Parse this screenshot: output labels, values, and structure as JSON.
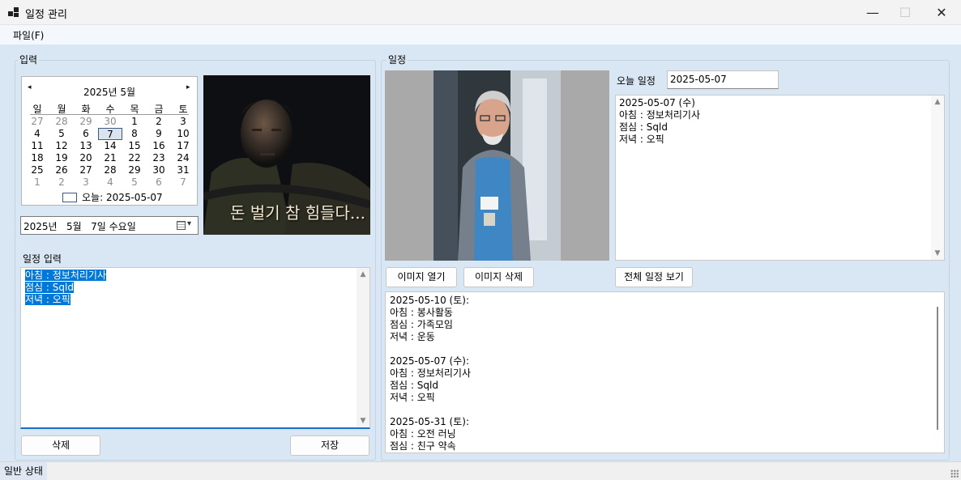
{
  "window": {
    "title": "일정 관리",
    "minimize": "—",
    "maximize": "☐",
    "close": "✕"
  },
  "menu": {
    "file": "파일(F)"
  },
  "input_group": {
    "title": "입력",
    "calendar": {
      "month_label": "2025년 5월",
      "prev": "◂",
      "next": "▸",
      "weekdays": [
        "일",
        "월",
        "화",
        "수",
        "목",
        "금",
        "토"
      ],
      "weeks": [
        [
          "27",
          "28",
          "29",
          "30",
          "1",
          "2",
          "3"
        ],
        [
          "4",
          "5",
          "6",
          "7",
          "8",
          "9",
          "10"
        ],
        [
          "11",
          "12",
          "13",
          "14",
          "15",
          "16",
          "17"
        ],
        [
          "18",
          "19",
          "20",
          "21",
          "22",
          "23",
          "24"
        ],
        [
          "25",
          "26",
          "27",
          "28",
          "29",
          "30",
          "31"
        ],
        [
          "1",
          "2",
          "3",
          "4",
          "5",
          "6",
          "7"
        ]
      ],
      "selected_day": "7",
      "today_label": "오늘: 2025-05-07"
    },
    "image_caption": "돈 벌기 참 힘들다...",
    "date_picker": {
      "value": "2025년   5월   7일 수요일",
      "icon": "calendar-icon",
      "dropdown": "▾"
    },
    "schedule_input": {
      "label": "일정 입력",
      "lines": [
        "아침 : 정보처리기사",
        "점심 : Sqld",
        "저녁 : 오픽"
      ]
    },
    "delete_button": "삭제",
    "save_button": "저장"
  },
  "schedule_group": {
    "title": "일정",
    "today_label": "오늘 일정",
    "today_date": "2025-05-07",
    "today_text": [
      "2025-05-07 (수)",
      "아침 : 정보처리기사",
      "점심 : Sqld",
      "저녁 : 오픽"
    ],
    "open_image_button": "이미지 열기",
    "delete_image_button": "이미지 삭제",
    "view_all_button": "전체 일정 보기",
    "all_schedules": [
      "2025-05-10 (토):",
      "아침 : 봉사활동",
      "점심 : 가족모임",
      "저녁 : 운동",
      "",
      "2025-05-07 (수):",
      "아침 : 정보처리기사",
      "점심 : Sqld",
      "저녁 : 오픽",
      "",
      "2025-05-31 (토):",
      "아침 : 오전 러닝",
      "점심 : 친구 약속"
    ]
  },
  "status": {
    "text": "일반 상태"
  },
  "colors": {
    "accent": "#0078d7",
    "window_bg": "#d9e6f4",
    "selection": "#0078d7"
  }
}
